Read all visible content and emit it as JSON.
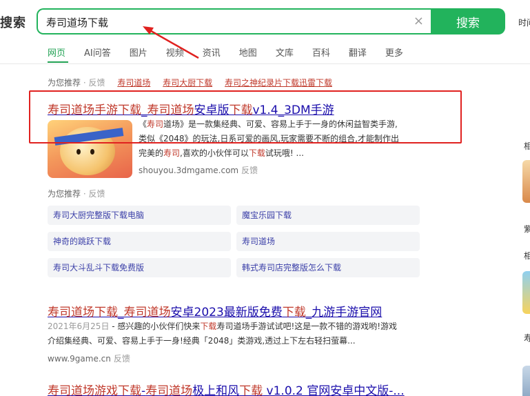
{
  "brand": {
    "logo": "搜索"
  },
  "search": {
    "value": "寿司道场下载",
    "button_label": "搜索",
    "clear_glyph": "×"
  },
  "top_right": {
    "text": "时间"
  },
  "tabs": [
    "网页",
    "AI问答",
    "图片",
    "视频",
    "资讯",
    "地图",
    "文库",
    "百科",
    "翻译",
    "更多"
  ],
  "active_tab": "网页",
  "recommend_top": {
    "label": "为您推荐",
    "sep": " · ",
    "feedback": "反馈",
    "links": [
      "寿司道场",
      "寿司大厨下载",
      "寿司之神纪录片下载迅雷下载"
    ]
  },
  "results": [
    {
      "title_hl1": "寿司道场手游下载",
      "title_plain1": "_",
      "title_hl2": "寿司道场",
      "title_plain2": "安卓版",
      "title_hl3": "下载",
      "title_plain3": "v1.4_3DM手游",
      "snippet_l1_a": "《",
      "snippet_l1_hl": "寿司",
      "snippet_l1_b": "道场》是一款集经典、可爱、容易上手于一身的休闲益智类手游,",
      "snippet_l2": "类似《2048》的玩法,日系可爱的画风,玩家需要不断的组合,才能制作出",
      "snippet_l3_a": "完美的",
      "snippet_l3_hl": "寿司",
      "snippet_l3_b": ",喜欢的小伙伴可以",
      "snippet_l3_hl2": "下载",
      "snippet_l3_c": "试玩哦! ...",
      "url": "shouyou.3dmgame.com",
      "feedback": "反馈"
    },
    {
      "title_hl1": "寿司道场下载",
      "title_plain1": "_",
      "title_hl2": "寿司道场",
      "title_plain2": "安卓2023最新版免费",
      "title_hl3": "下载",
      "title_plain3": "_九游手游官网",
      "date": "2021年6月25日",
      "snippet_l1_a": " - 感兴趣的小伙伴们快来",
      "snippet_l1_hl": "下载",
      "snippet_l1_b": "寿司道场手游试试吧!这是一款不错的游戏哟!游戏",
      "snippet_l2": "介绍集经典、可爱、容易上手于一身!经典「2048」类游戏,透过上下左右轻扫萤幕...",
      "url": "www.9game.cn",
      "feedback": "反馈"
    },
    {
      "title_hl1": "寿司道场游戏下载",
      "title_plain1": "-",
      "title_hl2": "寿司道场",
      "title_plain2": "极上和风",
      "title_hl3": "下载",
      "title_plain3": " v1.0.2 官网安卓中文版-..."
    }
  ],
  "recommend_mid": {
    "label": "为您推荐",
    "sep": " · ",
    "feedback": "反馈"
  },
  "related": [
    "寿司大厨完整版下载电脑",
    "魔宝乐园下载",
    "神奇的跳跃下载",
    "寿司道场",
    "寿司大斗乱斗下载免费版",
    "韩式寿司店完整版怎么下载"
  ],
  "sidebar": {
    "label1": "相",
    "label2": "紫",
    "label3": "相",
    "label4": "寿"
  },
  "colors": {
    "accent": "#22b35c",
    "link": "#1a0dab",
    "highlight": "#c0392b",
    "annotation": "#e0211f"
  }
}
